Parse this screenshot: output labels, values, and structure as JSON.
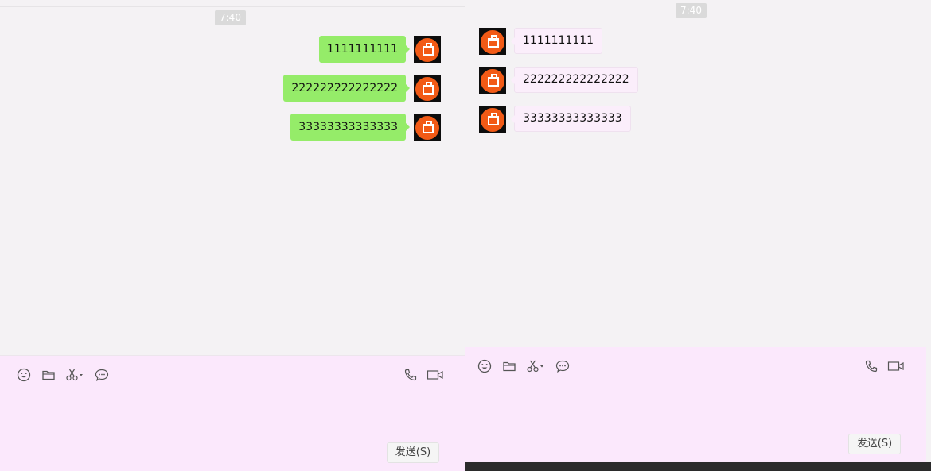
{
  "left_window": {
    "timestamp": "7:40",
    "messages": [
      {
        "text": "1111111111",
        "direction": "sent"
      },
      {
        "text": "222222222222222",
        "direction": "sent"
      },
      {
        "text": "33333333333333",
        "direction": "sent"
      }
    ],
    "send_label": "发送(S)"
  },
  "right_window": {
    "timestamp": "7:40",
    "messages": [
      {
        "text": "1111111111",
        "direction": "received"
      },
      {
        "text": "222222222222222",
        "direction": "received"
      },
      {
        "text": "33333333333333",
        "direction": "received"
      }
    ],
    "send_label": "发送(S)"
  },
  "toolbar_icons": [
    "emoji-icon",
    "folder-icon",
    "scissors-icon",
    "chat-bubble-icon",
    "phone-icon",
    "video-icon"
  ],
  "colors": {
    "sent_bubble": "#95ec69",
    "received_bubble": "#fbeefb",
    "composer_bg": "#fbe8fc",
    "chat_bg": "#f4f2f4",
    "avatar_accent": "#f25a16"
  }
}
